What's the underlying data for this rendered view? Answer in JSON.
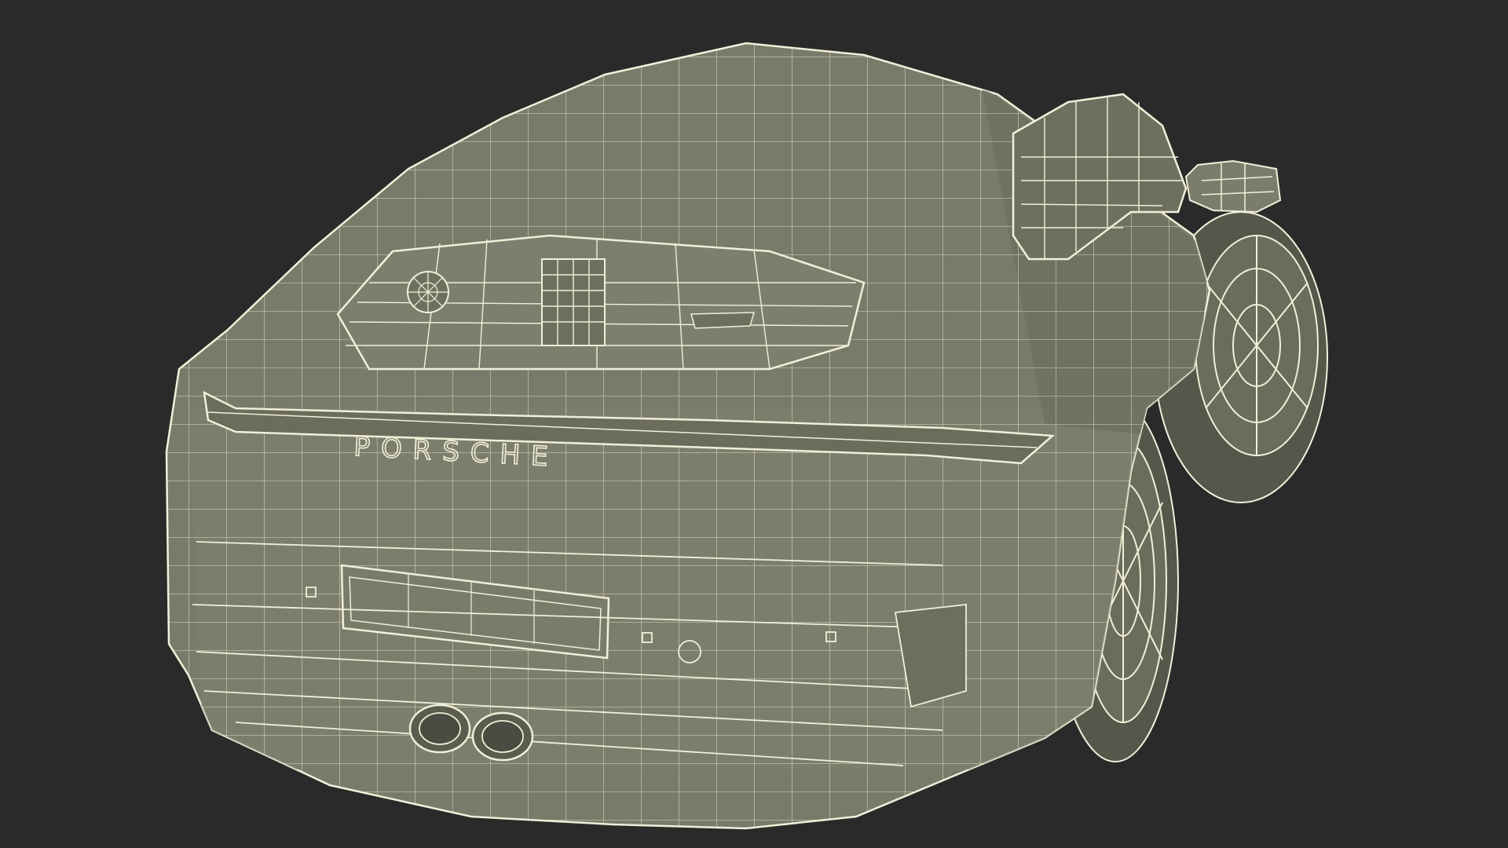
{
  "scene": {
    "subject": "wireframe-car-model",
    "colors": {
      "background": "#2a2a2a",
      "body": "#797b6a",
      "body_shadow": "#5f6153",
      "body_light": "#8a8c79",
      "wire": "#f1efd6",
      "wheel_dark": "#4a4c41"
    }
  },
  "badge": {
    "rear_lettering": "PORSCHE"
  }
}
